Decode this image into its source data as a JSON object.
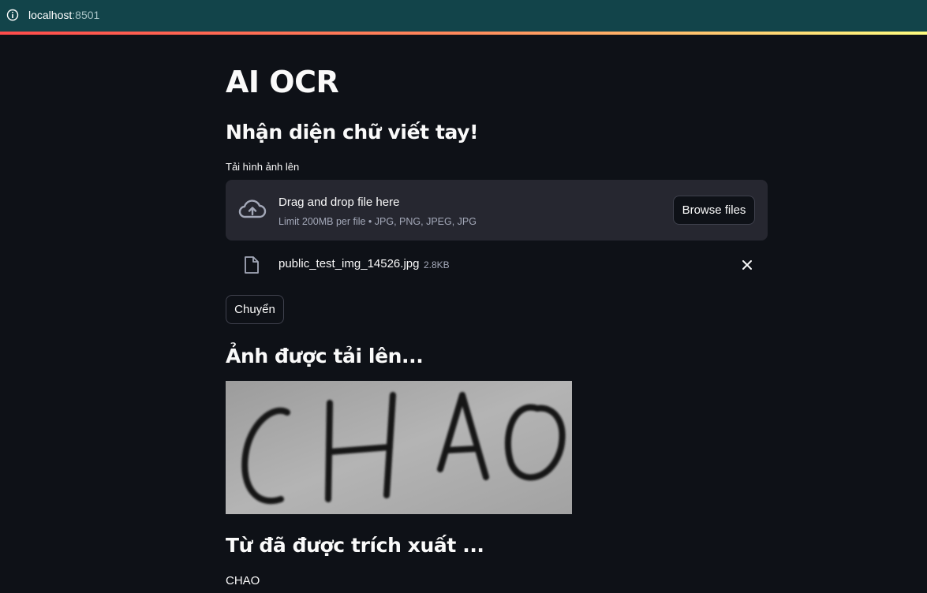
{
  "browser": {
    "url_host": "localhost",
    "url_port": ":8501",
    "icon": "info-icon"
  },
  "app": {
    "title": "AI OCR",
    "subtitle": "Nhận diện chữ viết tay!",
    "uploader": {
      "label": "Tải hình ảnh lên",
      "drop_text": "Drag and drop file here",
      "limit_text": "Limit 200MB per file • JPG, PNG, JPEG, JPG",
      "browse_label": "Browse files",
      "icon": "cloud-upload-icon"
    },
    "uploaded_file": {
      "name": "public_test_img_14526.jpg",
      "size": "2.8KB",
      "icon": "file-icon",
      "remove_icon": "close-icon"
    },
    "convert_label": "Chuyển",
    "uploaded_heading": "Ảnh được tải lên...",
    "image_content": "CHAO",
    "result_heading": "Từ đã được trích xuất ...",
    "result_text": "CHAO"
  },
  "colors": {
    "background": "#0e1117",
    "browser_bar": "#12444a",
    "dropzone": "#262730",
    "muted_text": "#a3a8b8",
    "accent_gradient": [
      "#ff4b4b",
      "#fffd80"
    ]
  }
}
